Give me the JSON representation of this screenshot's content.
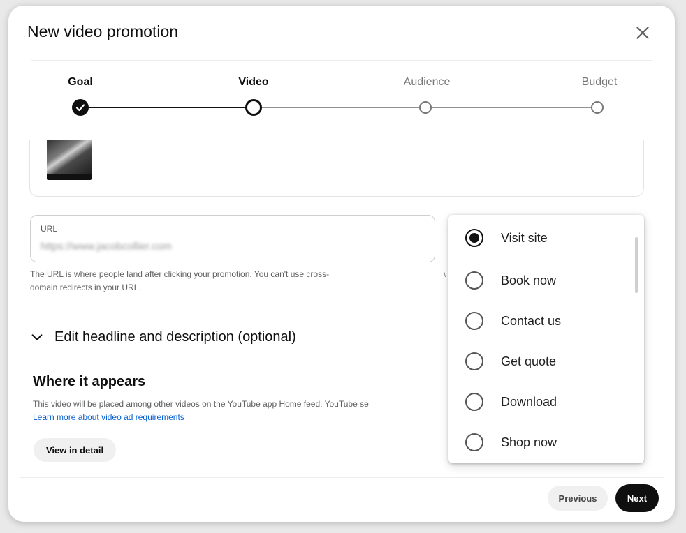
{
  "dialog": {
    "title": "New video promotion",
    "close_icon": "close-icon"
  },
  "stepper": {
    "steps": [
      {
        "label": "Goal",
        "state": "complete"
      },
      {
        "label": "Video",
        "state": "current"
      },
      {
        "label": "Audience",
        "state": "upcoming"
      },
      {
        "label": "Budget",
        "state": "upcoming"
      }
    ]
  },
  "url_field": {
    "label": "URL",
    "value": "https://www.jacobcollier.com",
    "help_line1": "The URL is where people land after clicking your promotion. You can't use cross-",
    "help_line2": "domain redirects in your URL."
  },
  "stray_mark": "\\",
  "expander": {
    "label": "Edit headline and description (optional)",
    "icon": "chevron-down-icon"
  },
  "where_it_appears": {
    "title": "Where it appears",
    "text": "This video will be placed among other videos on the YouTube app Home feed, YouTube se",
    "link": "Learn more about video ad requirements",
    "button": "View in detail"
  },
  "footer": {
    "previous": "Previous",
    "next": "Next"
  },
  "cta_dropdown": {
    "selected": "Visit site",
    "options": [
      "Visit site",
      "Book now",
      "Contact us",
      "Get quote",
      "Download",
      "Shop now"
    ]
  },
  "colors": {
    "primary": "#0f0f0f",
    "link": "#065fd4",
    "muted_text": "#606060"
  }
}
